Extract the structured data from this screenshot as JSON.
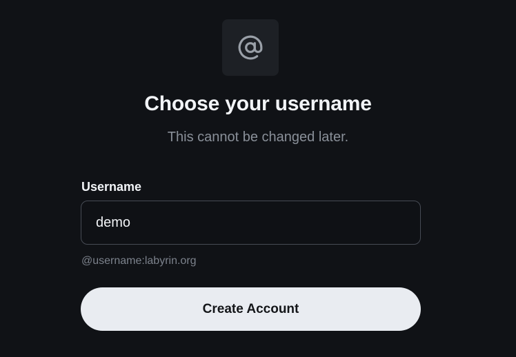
{
  "header": {
    "icon": "at-sign-icon",
    "title": "Choose your username",
    "subtitle": "This cannot be changed later."
  },
  "form": {
    "username_label": "Username",
    "username_value": "demo",
    "username_hint": "@username:labyrin.org",
    "submit_label": "Create Account"
  },
  "colors": {
    "background": "#101216",
    "icon_tile": "#1d2025",
    "icon": "#9aa0a8",
    "button_bg": "#e9ecf1",
    "button_text": "#141619",
    "muted_text": "#8a9099"
  }
}
